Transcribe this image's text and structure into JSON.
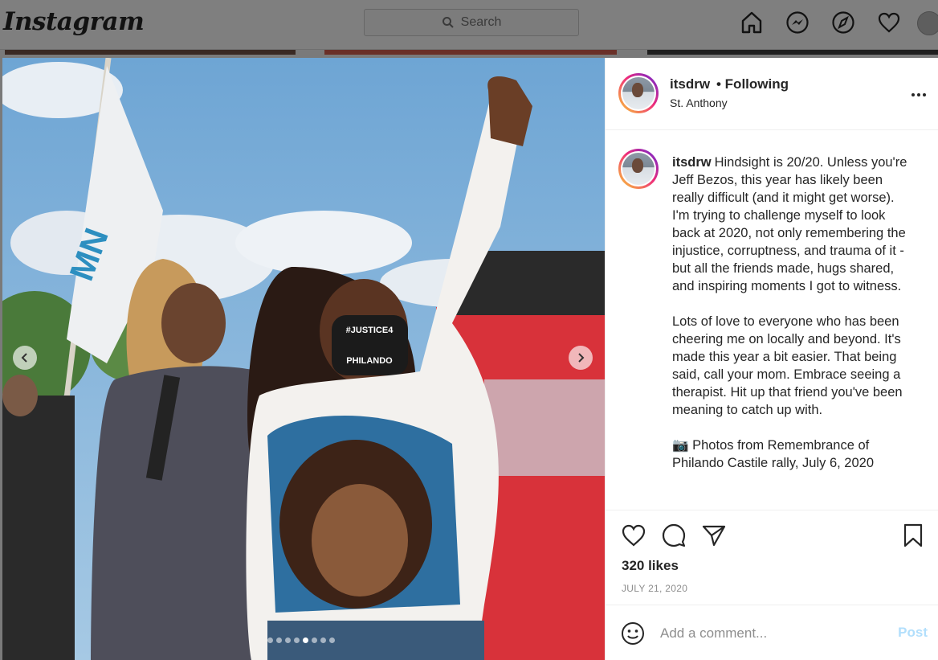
{
  "nav": {
    "logo": "Instagram",
    "search_placeholder": "Search",
    "icons": [
      "home-icon",
      "messenger-icon",
      "explore-icon",
      "activity-heart-icon",
      "profile-avatar"
    ]
  },
  "post": {
    "username": "itsdrw",
    "following": "• Following",
    "location": "St. Anthony",
    "caption_username": "itsdrw",
    "caption_p1": "Hindsight is 20/20. Unless you're Jeff Bezos, this year has likely been really difficult (and it might get worse). I'm trying to challenge myself to look back at 2020, not only remembering the injustice, corruptness, and trauma of it - but all the friends made, hugs shared, and inspiring moments I got to witness.",
    "caption_p2": "Lots of love to everyone who has been cheering me on locally and beyond. It's made this year a bit easier. That being said, call your mom. Embrace seeing a therapist. Hit up that friend you've been meaning to catch up with.",
    "caption_p3": "📷 Photos from Remembrance of Philando Castile rally, July 6, 2020",
    "likes": "320 likes",
    "date": "JULY 21, 2020",
    "comment_placeholder": "Add a comment...",
    "post_label": "Post",
    "photo_texts": {
      "mask_top": "#JUSTICE4",
      "mask_bottom": "PHILANDO",
      "flag_text": "MN"
    },
    "carousel": {
      "count": 8,
      "active_index": 4
    }
  },
  "colors": {
    "accent_blue": "#0095f6",
    "post_disabled": "#b2dffc",
    "secondary_text": "#8e8e8e",
    "story_ring": [
      "#f9ce34",
      "#ee2a7b",
      "#6228d7"
    ]
  }
}
